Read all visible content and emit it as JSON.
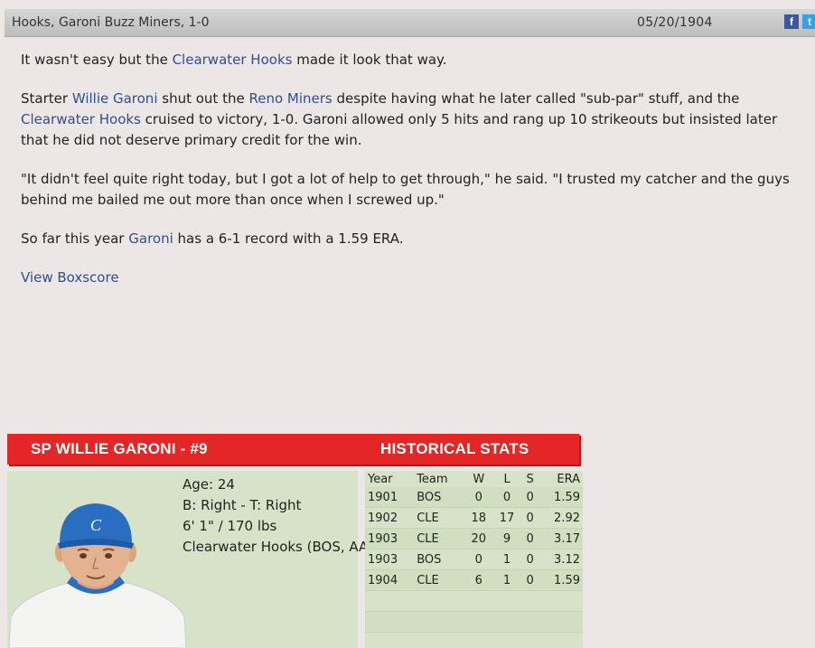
{
  "header": {
    "title": "Hooks, Garoni Buzz Miners, 1-0",
    "date": "05/20/1904",
    "share_facebook": "f",
    "share_twitter": "t"
  },
  "article": {
    "p1": {
      "a": "It wasn't easy but the ",
      "link1": "Clearwater Hooks",
      "b": " made it look that way."
    },
    "p2": {
      "a": "Starter ",
      "link1": "Willie Garoni",
      "b": " shut out the ",
      "link2": "Reno Miners",
      "c": " despite having what he later called \"sub-par\" stuff, and the ",
      "link3": "Clearwater Hooks",
      "d": " cruised to victory, 1-0. Garoni allowed only 5 hits and rang up 10 strikeouts but insisted later that he did not deserve primary credit for the win."
    },
    "p3": "\"It didn't feel quite right today, but I got a lot of help to get through,\" he said. \"I trusted my catcher and the guys behind me bailed me out more than once when I screwed up.\"",
    "p4": {
      "a": "So far this year ",
      "link1": "Garoni",
      "b": " has a 6-1 record with a 1.59 ERA."
    },
    "boxscore_link": "View Boxscore"
  },
  "player_card": {
    "name": "SP WILLIE GARONI - #9",
    "historical_title": "HISTORICAL STATS",
    "age": "Age: 24",
    "bats_throws": "B: Right - T: Right",
    "height_weight": "6' 1\" / 170 lbs",
    "team": "Clearwater Hooks (BOS, AAA)",
    "cap_logo": "C",
    "colors": {
      "header_red": "#e32626",
      "card_green": "#d6e3c8",
      "cap_blue": "#2a6ec2"
    }
  },
  "stats": {
    "headers": [
      "Year",
      "Team",
      "W",
      "L",
      "S",
      "ERA"
    ],
    "rows": [
      [
        "1901",
        "BOS",
        "0",
        "0",
        "0",
        "1.59"
      ],
      [
        "1902",
        "CLE",
        "18",
        "17",
        "0",
        "2.92"
      ],
      [
        "1903",
        "CLE",
        "20",
        "9",
        "0",
        "3.17"
      ],
      [
        "1903",
        "BOS",
        "0",
        "1",
        "0",
        "3.12"
      ],
      [
        "1904",
        "CLE",
        "6",
        "1",
        "0",
        "1.59"
      ]
    ]
  }
}
